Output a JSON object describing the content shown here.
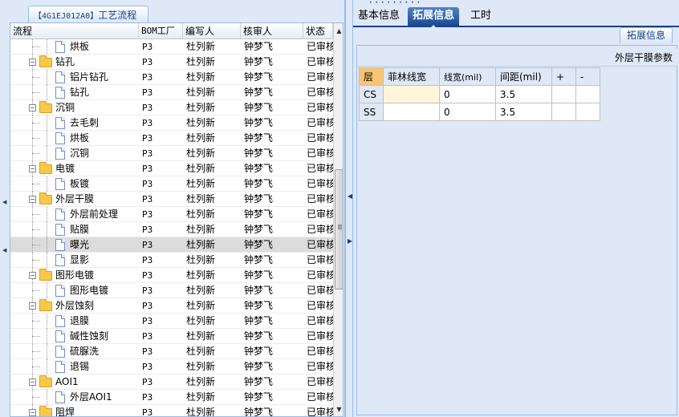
{
  "left_panel": {
    "title_code": "【4G1EJ012A0】",
    "title_text": "工艺流程",
    "columns": [
      "流程",
      "BOM工厂",
      "编写人",
      "核审人",
      "状态"
    ],
    "rows": [
      {
        "level": 2,
        "type": "file",
        "name": "烘板",
        "bom": "P3",
        "writer": "杜列新",
        "reviewer": "钟梦飞",
        "status": "已审核"
      },
      {
        "level": 1,
        "type": "folder",
        "name": "钻孔",
        "bom": "P3",
        "writer": "杜列新",
        "reviewer": "钟梦飞",
        "status": "已审核"
      },
      {
        "level": 2,
        "type": "file",
        "name": "铝片钻孔",
        "bom": "P3",
        "writer": "杜列新",
        "reviewer": "钟梦飞",
        "status": "已审核"
      },
      {
        "level": 2,
        "type": "file",
        "name": "钻孔",
        "bom": "P3",
        "writer": "杜列新",
        "reviewer": "钟梦飞",
        "status": "已审核"
      },
      {
        "level": 1,
        "type": "folder",
        "name": "沉铜",
        "bom": "P3",
        "writer": "杜列新",
        "reviewer": "钟梦飞",
        "status": "已审核"
      },
      {
        "level": 2,
        "type": "file",
        "name": "去毛刺",
        "bom": "P3",
        "writer": "杜列新",
        "reviewer": "钟梦飞",
        "status": "已审核"
      },
      {
        "level": 2,
        "type": "file",
        "name": "烘板",
        "bom": "P3",
        "writer": "杜列新",
        "reviewer": "钟梦飞",
        "status": "已审核"
      },
      {
        "level": 2,
        "type": "file",
        "name": "沉铜",
        "bom": "P3",
        "writer": "杜列新",
        "reviewer": "钟梦飞",
        "status": "已审核"
      },
      {
        "level": 1,
        "type": "folder",
        "name": "电镀",
        "bom": "P3",
        "writer": "杜列新",
        "reviewer": "钟梦飞",
        "status": "已审核"
      },
      {
        "level": 2,
        "type": "file",
        "name": "板镀",
        "bom": "P3",
        "writer": "杜列新",
        "reviewer": "钟梦飞",
        "status": "已审核"
      },
      {
        "level": 1,
        "type": "folder",
        "name": "外层干膜",
        "bom": "P3",
        "writer": "杜列新",
        "reviewer": "钟梦飞",
        "status": "已审核"
      },
      {
        "level": 2,
        "type": "file",
        "name": "外层前处理",
        "bom": "P3",
        "writer": "杜列新",
        "reviewer": "钟梦飞",
        "status": "已审核"
      },
      {
        "level": 2,
        "type": "file",
        "name": "贴膜",
        "bom": "P3",
        "writer": "杜列新",
        "reviewer": "钟梦飞",
        "status": "已审核"
      },
      {
        "level": 2,
        "type": "file",
        "name": "曝光",
        "bom": "P3",
        "writer": "杜列新",
        "reviewer": "钟梦飞",
        "status": "已审核",
        "selected": true
      },
      {
        "level": 2,
        "type": "file",
        "name": "显影",
        "bom": "P3",
        "writer": "杜列新",
        "reviewer": "钟梦飞",
        "status": "已审核"
      },
      {
        "level": 1,
        "type": "folder",
        "name": "图形电镀",
        "bom": "P3",
        "writer": "杜列新",
        "reviewer": "钟梦飞",
        "status": "已审核"
      },
      {
        "level": 2,
        "type": "file",
        "name": "图形电镀",
        "bom": "P3",
        "writer": "杜列新",
        "reviewer": "钟梦飞",
        "status": "已审核"
      },
      {
        "level": 1,
        "type": "folder",
        "name": "外层蚀刻",
        "bom": "P3",
        "writer": "杜列新",
        "reviewer": "钟梦飞",
        "status": "已审核"
      },
      {
        "level": 2,
        "type": "file",
        "name": "退膜",
        "bom": "P3",
        "writer": "杜列新",
        "reviewer": "钟梦飞",
        "status": "已审核"
      },
      {
        "level": 2,
        "type": "file",
        "name": "碱性蚀刻",
        "bom": "P3",
        "writer": "杜列新",
        "reviewer": "钟梦飞",
        "status": "已审核"
      },
      {
        "level": 2,
        "type": "file",
        "name": "硫脲洗",
        "bom": "P3",
        "writer": "杜列新",
        "reviewer": "钟梦飞",
        "status": "已审核"
      },
      {
        "level": 2,
        "type": "file",
        "name": "退锡",
        "bom": "P3",
        "writer": "杜列新",
        "reviewer": "钟梦飞",
        "status": "已审核"
      },
      {
        "level": 1,
        "type": "folder",
        "name": "AOI1",
        "bom": "P3",
        "writer": "杜列新",
        "reviewer": "钟梦飞",
        "status": "已审核"
      },
      {
        "level": 2,
        "type": "file",
        "name": "外层AOI1",
        "bom": "P3",
        "writer": "杜列新",
        "reviewer": "钟梦飞",
        "status": "已审核"
      },
      {
        "level": 1,
        "type": "folder",
        "name": "阻焊",
        "bom": "P3",
        "writer": "杜列新",
        "reviewer": "钟梦飞",
        "status": "已审核"
      }
    ]
  },
  "right_panel": {
    "tabs": [
      "基本信息",
      "拓展信息",
      "工时"
    ],
    "active_tab": "拓展信息",
    "sub_tab": "拓展信息",
    "section_title": "外层干膜参数",
    "table": {
      "headers": [
        "层",
        "菲林线宽",
        "线宽(mil)",
        "间距(mil)",
        "+",
        "-"
      ],
      "rows": [
        {
          "layer": "CS",
          "film": "",
          "width": "0",
          "spacing": "3.5"
        },
        {
          "layer": "SS",
          "film": "",
          "width": "0",
          "spacing": "3.5"
        }
      ]
    }
  },
  "colors": {
    "accent": "#15428b",
    "panel_bg": "#dfe8f6",
    "border": "#99bbe8",
    "corner_header": "#f9c574",
    "editable_cell": "#fff6d9"
  }
}
